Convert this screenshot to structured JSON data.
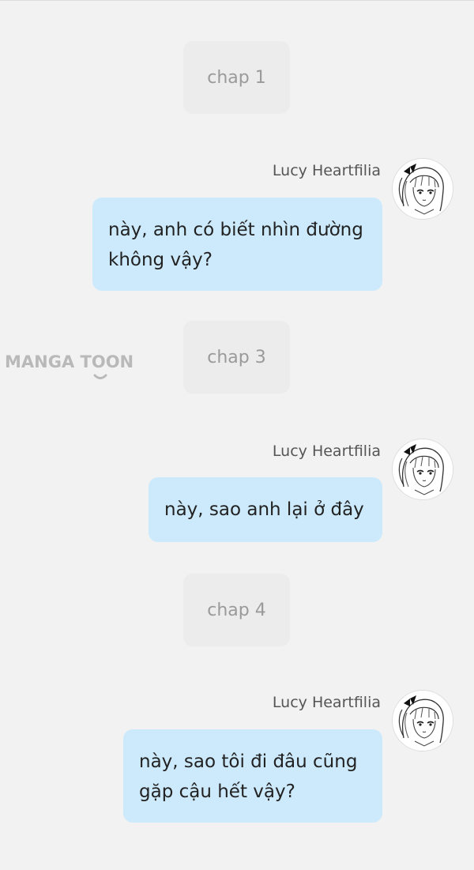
{
  "messages_view": {
    "dividers": [
      {
        "label": "chap 1"
      },
      {
        "label": "chap 3"
      },
      {
        "label": "chap 4"
      }
    ],
    "messages": [
      {
        "sender": "Lucy Heartfilia",
        "text": "này, anh có biết nhìn đường không vậy?"
      },
      {
        "sender": "Lucy Heartfilia",
        "text": "này, sao anh lại ở đây"
      },
      {
        "sender": "Lucy Heartfilia",
        "text": "này, sao tôi đi đâu cũng gặp cậu hết vậy?"
      }
    ]
  },
  "watermark": {
    "text": "MANGA TOON"
  },
  "colors": {
    "background": "#f2f2f2",
    "divider_bg": "#ececec",
    "divider_text": "#9a9a9a",
    "bubble_bg": "#cdeafc",
    "bubble_text": "#222222",
    "name_text": "#555555"
  },
  "icons": {
    "avatar": "anime-girl-avatar-icon"
  }
}
